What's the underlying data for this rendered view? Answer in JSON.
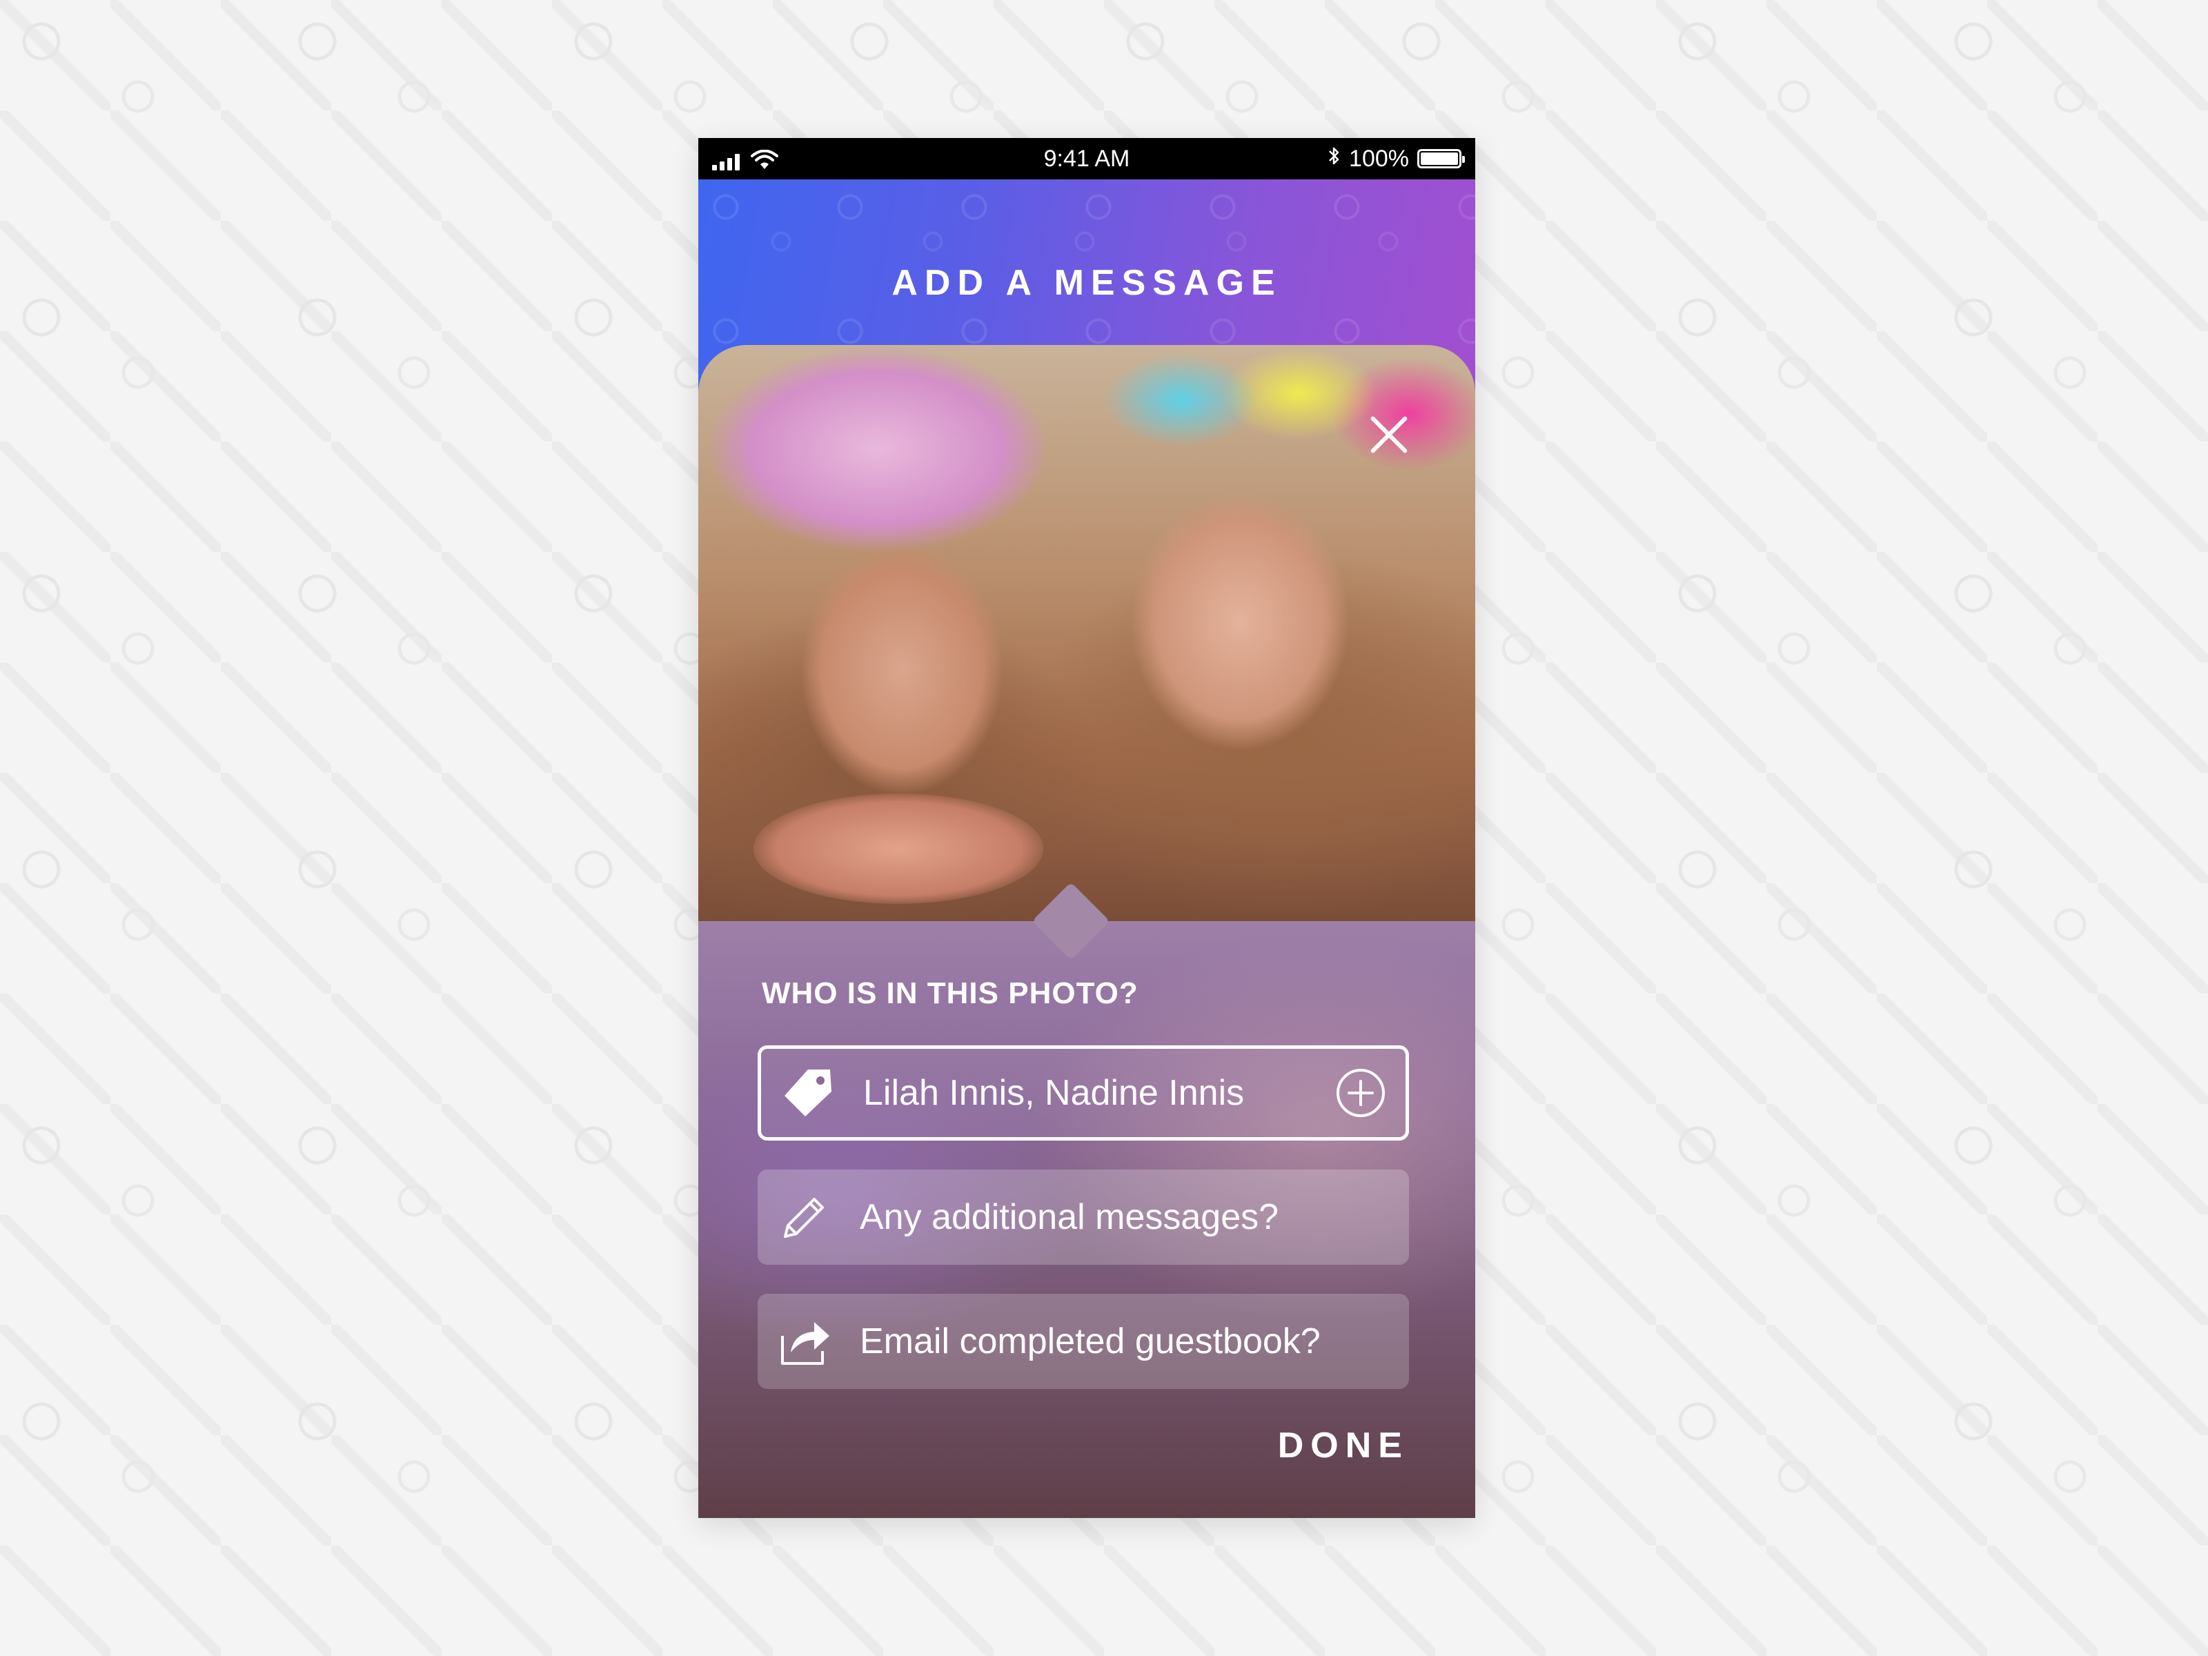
{
  "status_bar": {
    "time": "9:41 AM",
    "battery": "100%",
    "battery_level": 1.0,
    "icons": [
      "signal-icon",
      "wifi-icon",
      "bluetooth-icon",
      "battery-icon"
    ]
  },
  "header": {
    "title": "ADD A MESSAGE"
  },
  "photo": {
    "close_icon": "close-icon"
  },
  "form": {
    "label": "WHO IS IN THIS PHOTO?",
    "tagged_people": "Lilah Innis, Nadine Innis",
    "tag_icon": "tag-icon",
    "add_icon": "add-circle-icon",
    "message_placeholder": "Any additional messages?",
    "message_icon": "pencil-icon",
    "email_placeholder": "Email completed guestbook?",
    "email_icon": "share-icon",
    "done_label": "DONE"
  },
  "colors": {
    "header_gradient_start": "#3f66f0",
    "header_gradient_end": "#a24fd0",
    "text": "#ffffff"
  }
}
